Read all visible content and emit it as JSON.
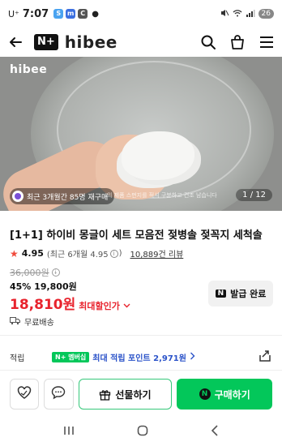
{
  "status": {
    "carrier": "U⁺",
    "time": "7:07",
    "app_icons": [
      "S",
      "m",
      "C"
    ],
    "battery": "26"
  },
  "header": {
    "nplus_label": "N+",
    "brand": "hibee"
  },
  "gallery": {
    "logo": "hibee",
    "buyer_notice": "최근 3개월간 85명 재구매",
    "caption": "…의 제품 스펀지를 적셔 구분하고 건조 남습니다",
    "counter": "1 / 12"
  },
  "product": {
    "title": "[1+1] 하이비 몽글이 세트 모음전 젖병솔 젖꼭지 세척솔",
    "rating_score": "4.95",
    "rating_detail": "(최근 6개월 4.95",
    "rating_close": ")",
    "review_count": "10,889건 리뷰",
    "original_price": "36,000원",
    "discount_text": "45% 19,800원",
    "final_price": "18,810원",
    "max_discount_label": "최대할인가",
    "coupon_label": "발급 완료",
    "shipping": "무료배송"
  },
  "points": {
    "label": "적립",
    "badge": "N+ 멤버십",
    "text": "최대 적립 포인트 2,971원"
  },
  "actions": {
    "gift_label": "선물하기",
    "buy_label": "구매하기"
  },
  "colors": {
    "naver_green": "#03c75a",
    "sale_red": "#e8232d",
    "points_blue": "#2b53c9"
  }
}
